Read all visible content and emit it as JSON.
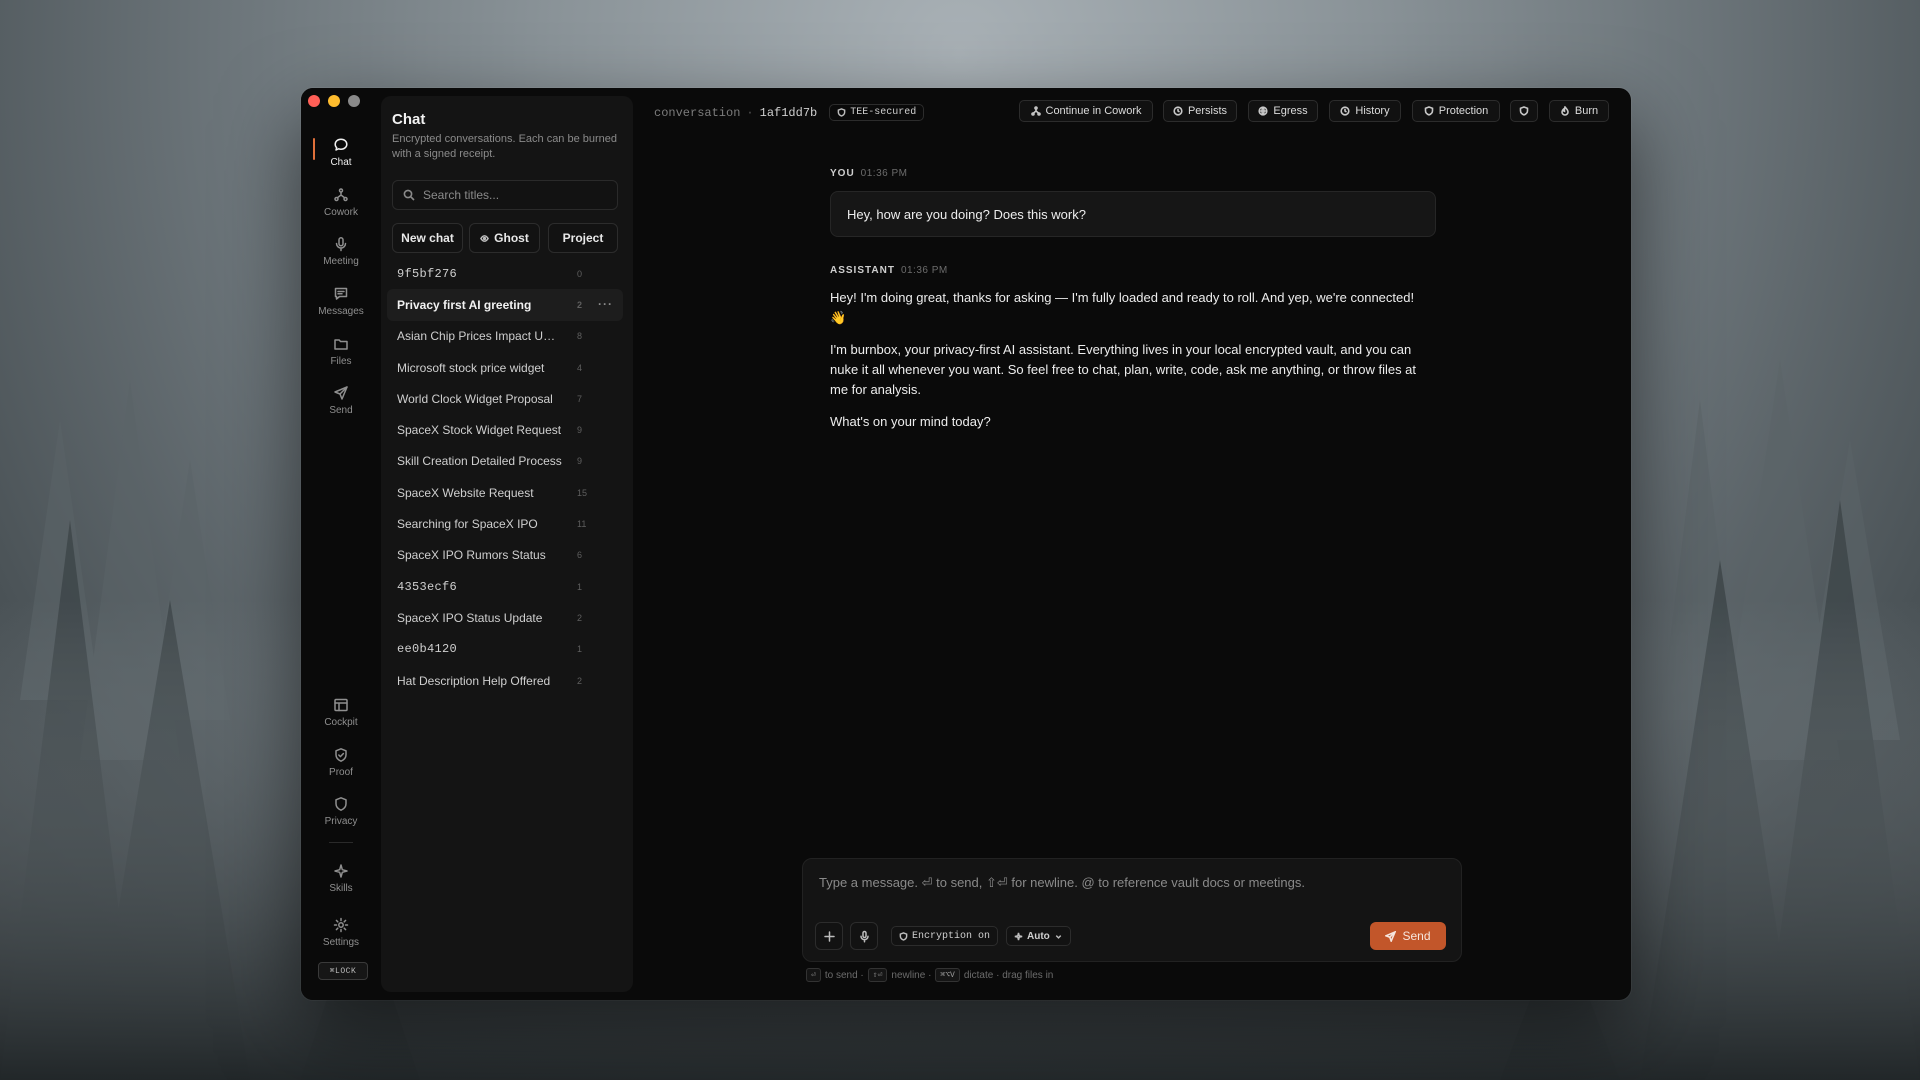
{
  "rail": {
    "top_items": [
      {
        "label": "Chat",
        "icon": "chat-bubble-icon",
        "active": true
      },
      {
        "label": "Cowork",
        "icon": "cowork-icon"
      },
      {
        "label": "Meeting",
        "icon": "microphone-icon"
      },
      {
        "label": "Messages",
        "icon": "messages-icon"
      },
      {
        "label": "Files",
        "icon": "folder-icon"
      },
      {
        "label": "Send",
        "icon": "send-icon"
      }
    ],
    "bottom_items": [
      {
        "label": "Cockpit",
        "icon": "cockpit-icon"
      },
      {
        "label": "Proof",
        "icon": "shield-check-icon"
      },
      {
        "label": "Privacy",
        "icon": "shield-icon"
      },
      {
        "label": "Skills",
        "icon": "sparkle-icon"
      },
      {
        "label": "Settings",
        "icon": "gear-icon"
      }
    ],
    "lock_label": "⌘LOCK"
  },
  "panel": {
    "title": "Chat",
    "subtitle": "Encrypted conversations. Each can be burned with a signed receipt.",
    "search_placeholder": "Search titles...",
    "buttons": {
      "new_chat": "New chat",
      "ghost": "Ghost",
      "project": "Project"
    },
    "conversations": [
      {
        "title": "9f5bf276",
        "count": "0",
        "mono": true
      },
      {
        "title": "Privacy first AI greeting",
        "count": "2",
        "active": true
      },
      {
        "title": "Asian Chip Prices Impact US Markets",
        "count": "8"
      },
      {
        "title": "Microsoft stock price widget",
        "count": "4"
      },
      {
        "title": "World Clock Widget Proposal",
        "count": "7"
      },
      {
        "title": "SpaceX Stock Widget Request",
        "count": "9"
      },
      {
        "title": "Skill Creation Detailed Process",
        "count": "9"
      },
      {
        "title": "SpaceX Website Request",
        "count": "15"
      },
      {
        "title": "Searching for SpaceX IPO",
        "count": "11"
      },
      {
        "title": "SpaceX IPO Rumors Status",
        "count": "6"
      },
      {
        "title": "4353ecf6",
        "count": "1",
        "mono": true
      },
      {
        "title": "SpaceX IPO Status Update",
        "count": "2"
      },
      {
        "title": "ee0b4120",
        "count": "1",
        "mono": true
      },
      {
        "title": "Hat Description Help Offered",
        "count": "2"
      }
    ]
  },
  "topbar": {
    "crumb_label": "conversation",
    "separator": "·",
    "conversation_id": "1af1dd7b",
    "tee_badge": "TEE-secured",
    "actions": {
      "continue": "Continue in Cowork",
      "persists": "Persists",
      "egress": "Egress",
      "history": "History",
      "protection": "Protection",
      "burn": "Burn"
    }
  },
  "messages": {
    "user_role": "YOU",
    "user_time": "01:36 PM",
    "user_text": "Hey, how are you doing? Does this work?",
    "assistant_role": "ASSISTANT",
    "assistant_time": "01:36 PM",
    "assistant_p1": "Hey! I'm doing great, thanks for asking — I'm fully loaded and ready to roll. And yep, we're connected! 👋",
    "assistant_p2": "I'm burnbox, your privacy-first AI assistant. Everything lives in your local encrypted vault, and you can nuke it all whenever you want. So feel free to chat, plan, write, code, ask me anything, or throw files at me for analysis.",
    "assistant_p3": "What's on your mind today?"
  },
  "composer": {
    "placeholder": "Type a message. ⏎ to send, ⇧⏎ for newline. @ to reference vault docs or meetings.",
    "encryption_chip": "Encryption on",
    "model_chip": "Auto",
    "send_label": "Send",
    "hints": {
      "send_key": "⏎",
      "send_text": "to send ·",
      "newline_key": "⇧⏎",
      "newline_text": "newline ·",
      "dictate_key": "⌘⌥V",
      "dictate_text": "dictate · drag files in"
    }
  },
  "colors": {
    "accent": "#e0703a",
    "send_button": "#c2562a",
    "window_bg": "#0a0a0a",
    "panel_bg": "#141414"
  }
}
